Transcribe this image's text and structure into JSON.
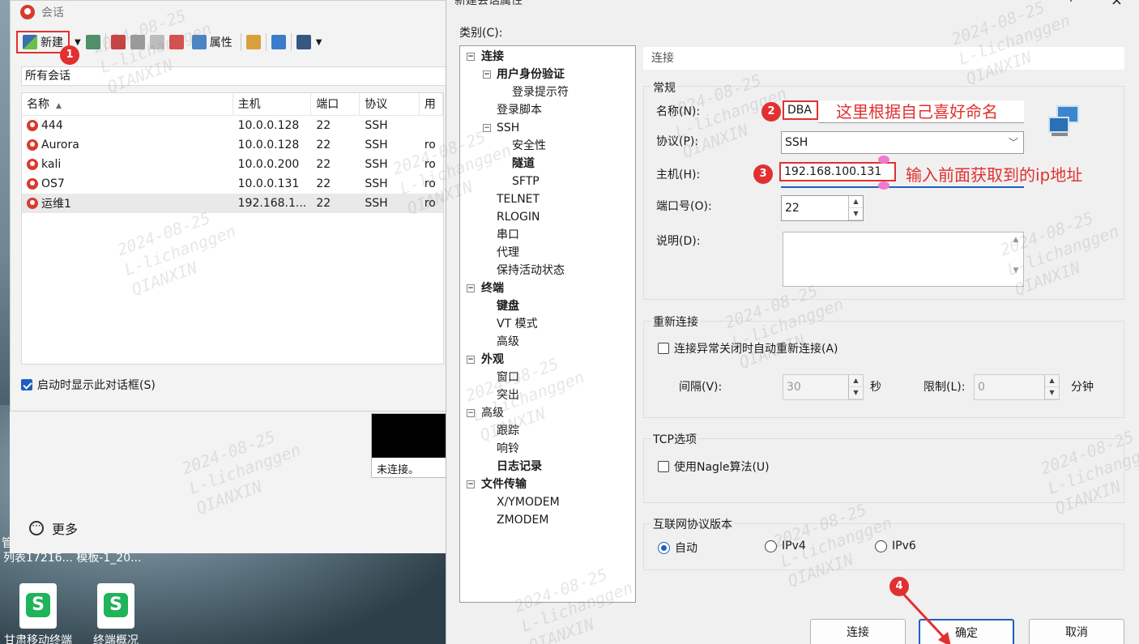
{
  "session_window": {
    "title": "会话",
    "toolbar": {
      "new_label": "新建",
      "properties_label": "属性"
    },
    "breadcrumb": "所有会话",
    "columns": [
      "名称",
      "主机",
      "端口",
      "协议",
      "用"
    ],
    "sessions": [
      {
        "name": "444",
        "host": "10.0.0.128",
        "port": "22",
        "protocol": "SSH",
        "user": ""
      },
      {
        "name": "Aurora",
        "host": "10.0.0.128",
        "port": "22",
        "protocol": "SSH",
        "user": "ro"
      },
      {
        "name": "kali",
        "host": "10.0.0.200",
        "port": "22",
        "protocol": "SSH",
        "user": "ro"
      },
      {
        "name": "OS7",
        "host": "10.0.0.131",
        "port": "22",
        "protocol": "SSH",
        "user": "ro"
      },
      {
        "name": "运维1",
        "host": "192.168.1...",
        "port": "22",
        "protocol": "SSH",
        "user": "ro"
      }
    ],
    "show_on_startup_label": "启动时显示此对话框(S)",
    "more_label": "更多",
    "terminal_status": "未连接。"
  },
  "desktop": {
    "caption_row": "列表17216...   模板-1_20...",
    "icon1_label": "甘肃移动终端",
    "icon2_label": "终端概况",
    "side_char": "管"
  },
  "dialog": {
    "title": "新建会话属性",
    "help": "?",
    "category_label": "类别(C):",
    "tree": [
      {
        "label": "连接",
        "level": 0,
        "bold": true,
        "box": "−"
      },
      {
        "label": "用户身份验证",
        "level": 1,
        "bold": true,
        "box": "−"
      },
      {
        "label": "登录提示符",
        "level": 2,
        "bold": false,
        "box": ""
      },
      {
        "label": "登录脚本",
        "level": 1,
        "bold": false,
        "box": ""
      },
      {
        "label": "SSH",
        "level": 1,
        "bold": false,
        "box": "−"
      },
      {
        "label": "安全性",
        "level": 2,
        "bold": false,
        "box": ""
      },
      {
        "label": "隧道",
        "level": 2,
        "bold": true,
        "box": ""
      },
      {
        "label": "SFTP",
        "level": 2,
        "bold": false,
        "box": ""
      },
      {
        "label": "TELNET",
        "level": 1,
        "bold": false,
        "box": ""
      },
      {
        "label": "RLOGIN",
        "level": 1,
        "bold": false,
        "box": ""
      },
      {
        "label": "串口",
        "level": 1,
        "bold": false,
        "box": ""
      },
      {
        "label": "代理",
        "level": 1,
        "bold": false,
        "box": ""
      },
      {
        "label": "保持活动状态",
        "level": 1,
        "bold": false,
        "box": ""
      },
      {
        "label": "终端",
        "level": 0,
        "bold": true,
        "box": "−"
      },
      {
        "label": "键盘",
        "level": 1,
        "bold": true,
        "box": ""
      },
      {
        "label": "VT 模式",
        "level": 1,
        "bold": false,
        "box": ""
      },
      {
        "label": "高级",
        "level": 1,
        "bold": false,
        "box": ""
      },
      {
        "label": "外观",
        "level": 0,
        "bold": true,
        "box": "−"
      },
      {
        "label": "窗口",
        "level": 1,
        "bold": false,
        "box": ""
      },
      {
        "label": "突出",
        "level": 1,
        "bold": false,
        "box": ""
      },
      {
        "label": "高级",
        "level": 0,
        "bold": false,
        "box": "−"
      },
      {
        "label": "跟踪",
        "level": 1,
        "bold": false,
        "box": ""
      },
      {
        "label": "响铃",
        "level": 1,
        "bold": false,
        "box": ""
      },
      {
        "label": "日志记录",
        "level": 1,
        "bold": true,
        "box": ""
      },
      {
        "label": "文件传输",
        "level": 0,
        "bold": true,
        "box": "−"
      },
      {
        "label": "X/YMODEM",
        "level": 1,
        "bold": false,
        "box": ""
      },
      {
        "label": "ZMODEM",
        "level": 1,
        "bold": false,
        "box": ""
      }
    ],
    "section_header": "连接",
    "general": {
      "group_label": "常规",
      "name_label": "名称(N):",
      "name_value": "DBA",
      "protocol_label": "协议(P):",
      "protocol_value": "SSH",
      "host_label": "主机(H):",
      "host_value": "192.168.100.131",
      "port_label": "端口号(O):",
      "port_value": "22",
      "desc_label": "说明(D):"
    },
    "reconnect": {
      "group_label": "重新连接",
      "checkbox_label": "连接异常关闭时自动重新连接(A)",
      "interval_label": "间隔(V):",
      "interval_value": "30",
      "interval_unit": "秒",
      "limit_label": "限制(L):",
      "limit_value": "0",
      "limit_unit": "分钟"
    },
    "tcp": {
      "group_label": "TCP选项",
      "nagle_label": "使用Nagle算法(U)"
    },
    "ip_version": {
      "group_label": "互联网协议版本",
      "options": [
        "自动",
        "IPv4",
        "IPv6"
      ],
      "selected": "自动"
    },
    "buttons": {
      "connect": "连接",
      "ok": "确定",
      "cancel": "取消"
    }
  },
  "annotations": {
    "step1": "1",
    "step2": "2",
    "step3": "3",
    "step4": "4",
    "name_note": "这里根据自己喜好命名",
    "host_note": "输入前面获取到的ip地址",
    "watermark": "2024-08-25\nL-lichanggen\nQIANXIN"
  },
  "colors": {
    "accent": "#1f5fbf",
    "annotation": "#e23030"
  }
}
